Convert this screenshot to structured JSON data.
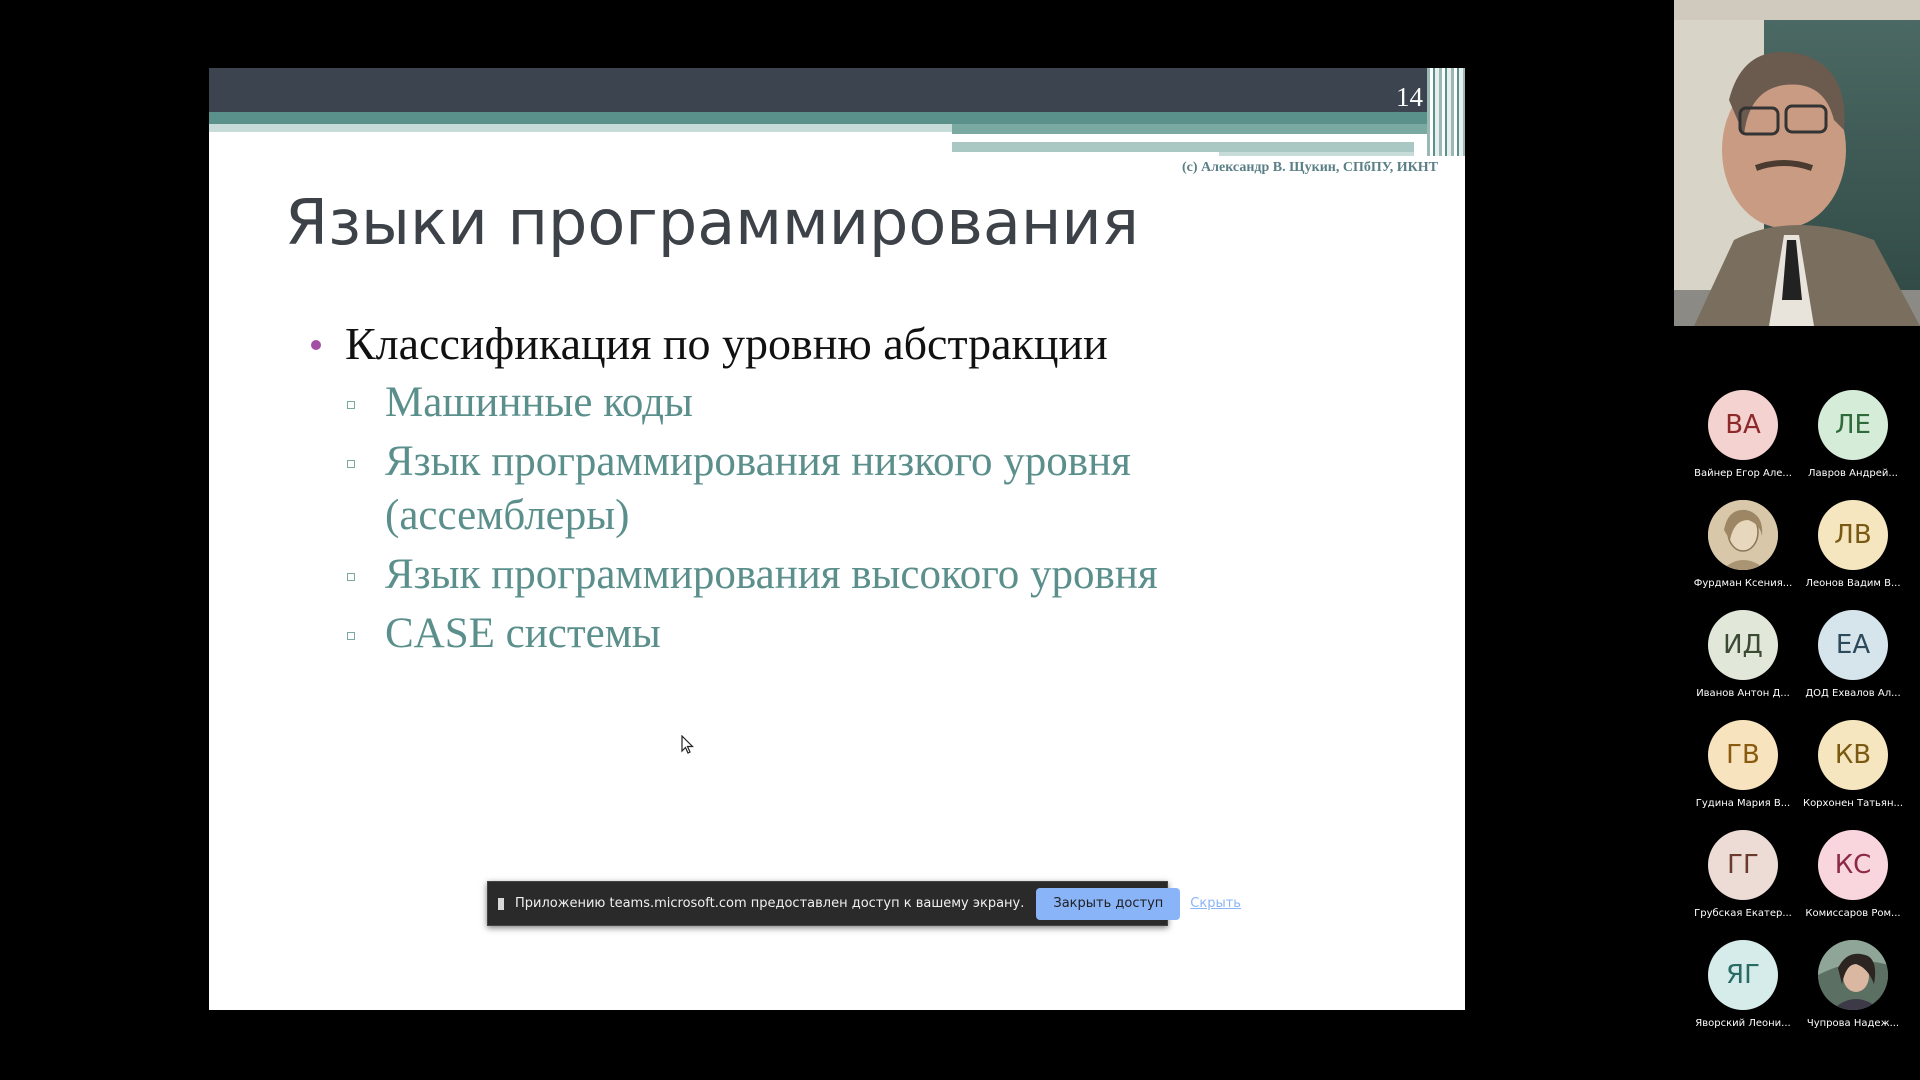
{
  "slide": {
    "page_number": "14",
    "copyright": "(с) Александр В. Щукин, СПбПУ, ИКНТ",
    "title": "Языки программирования",
    "bullet": "Классификация по уровню абстракции",
    "sub_bullets": [
      "Машинные коды",
      "Язык программирования низкого уровня (ассемблеры)",
      "Язык программирования высокого уровня",
      "CASE системы"
    ],
    "colors": {
      "top_bar": "#3c4450",
      "accent_teal": "#5a918a",
      "bullet_dot": "#a34ea5",
      "sub_text": "#5b8f8c"
    }
  },
  "share_bar": {
    "icon": "pause-icon",
    "message": "Приложению teams.microsoft.com предоставлен доступ к вашему экрану.",
    "stop_label": "Закрыть доступ",
    "hide_label": "Скрыть"
  },
  "participants": [
    {
      "initials": "ВА",
      "name": "Вайнер Егор Але...",
      "bg": "#f4d2d0",
      "fg": "#8c2a2a"
    },
    {
      "initials": "ЛЕ",
      "name": "Лавров Андрей...",
      "bg": "#d5ecd9",
      "fg": "#2f6a3a"
    },
    {
      "initials": "",
      "name": "Фурдман Ксения...",
      "bg": "#c9b79a",
      "fg": "#5a4a33",
      "photo": true
    },
    {
      "initials": "ЛВ",
      "name": "Леонов Вадим В...",
      "bg": "#f6e6bf",
      "fg": "#7a5a12"
    },
    {
      "initials": "ИД",
      "name": "Иванов Антон Д...",
      "bg": "#e1e8da",
      "fg": "#3c4a33"
    },
    {
      "initials": "ЕА",
      "name": "ДОД Ехвалов Ал...",
      "bg": "#d6e4ec",
      "fg": "#2d4a5a"
    },
    {
      "initials": "ГВ",
      "name": "Гудина Мария В...",
      "bg": "#f7e3bd",
      "fg": "#8a5a0e"
    },
    {
      "initials": "КВ",
      "name": "Корхонен Татьян...",
      "bg": "#f6e6bf",
      "fg": "#7a5a12"
    },
    {
      "initials": "ГГ",
      "name": "Грубская Екатер...",
      "bg": "#eddcd6",
      "fg": "#6a3a2e"
    },
    {
      "initials": "КС",
      "name": "Комиссаров Ром...",
      "bg": "#f9d6dd",
      "fg": "#8c2a45"
    },
    {
      "initials": "ЯГ",
      "name": "Яворский Леони...",
      "bg": "#d6ecea",
      "fg": "#2a6a64"
    },
    {
      "initials": "",
      "name": "Чупрова Надеж...",
      "bg": "#6a7a6a",
      "fg": "#ffffff",
      "photo": true
    }
  ]
}
